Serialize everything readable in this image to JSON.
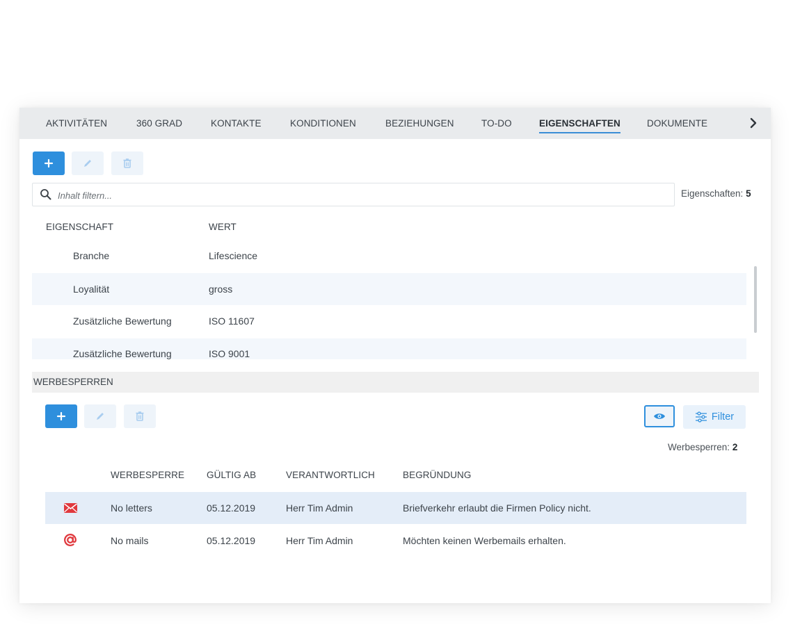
{
  "tabs": {
    "items": [
      {
        "label": "AKTIVITÄTEN"
      },
      {
        "label": "360 GRAD"
      },
      {
        "label": "KONTAKTE"
      },
      {
        "label": "KONDITIONEN"
      },
      {
        "label": "BEZIEHUNGEN"
      },
      {
        "label": "TO-DO"
      },
      {
        "label": "EIGENSCHAFTEN",
        "active": true
      },
      {
        "label": "DOKUMENTE"
      }
    ],
    "more_icon": "chevron-right-icon"
  },
  "properties": {
    "toolbar": {
      "add_icon": "plus-icon",
      "edit_icon": "pencil-icon",
      "delete_icon": "trash-icon"
    },
    "filter": {
      "icon": "search-icon",
      "placeholder": "Inhalt filtern..."
    },
    "count_label": "Eigenschaften:",
    "count_value": "5",
    "columns": {
      "property": "EIGENSCHAFT",
      "value": "WERT"
    },
    "rows": [
      {
        "property": "Branche",
        "value": "Lifescience"
      },
      {
        "property": "Loyalität",
        "value": "gross"
      },
      {
        "property": "Zusätzliche Bewertung",
        "value": "ISO 11607"
      },
      {
        "property": "Zusätzliche Bewertung",
        "value": "ISO 9001"
      }
    ]
  },
  "werbesperren": {
    "section_title": "WERBESPERREN",
    "toolbar": {
      "add_icon": "plus-icon",
      "edit_icon": "pencil-icon",
      "delete_icon": "trash-icon",
      "view_icon": "eye-icon",
      "filter_icon": "sliders-icon",
      "filter_label": "Filter"
    },
    "count_label": "Werbesperren:",
    "count_value": "2",
    "columns": {
      "type": "WERBESPERRE",
      "valid_from": "GÜLTIG AB",
      "responsible": "VERANTWORTLICH",
      "reason": "BEGRÜNDUNG"
    },
    "rows": [
      {
        "icon": "envelope-icon",
        "type": "No letters",
        "valid_from": "05.12.2019",
        "responsible": "Herr Tim Admin",
        "reason": "Briefverkehr erlaubt die Firmen Policy nicht."
      },
      {
        "icon": "at-sign-icon",
        "type": "No mails",
        "valid_from": "05.12.2019",
        "responsible": "Herr Tim Admin",
        "reason": "Möchten keinen Werbemails erhalten."
      }
    ]
  },
  "colors": {
    "accent": "#2e8fdd",
    "tab_bar": "#e9ebed",
    "icon_red": "#e0393e",
    "row_highlight": "#e4edf8"
  }
}
